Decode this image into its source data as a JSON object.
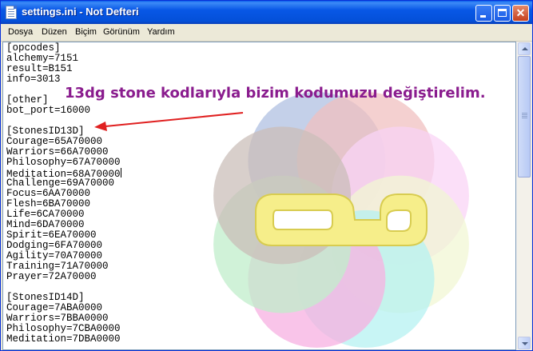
{
  "window": {
    "title": "settings.ini - Not Defteri"
  },
  "menu": [
    "Dosya",
    "Düzen",
    "Biçim",
    "Görünüm",
    "Yardım"
  ],
  "document": {
    "lines": [
      "[opcodes]",
      "alchemy=7151",
      "result=B151",
      "info=3013",
      "",
      "[other]",
      "bot_port=16000",
      "",
      "[StonesID13D]",
      "Courage=65A70000",
      "Warriors=66A70000",
      "Philosophy=67A70000",
      "Meditation=68A70000",
      "Challenge=69A70000",
      "Focus=6AA70000",
      "Flesh=6BA70000",
      "Life=6CA70000",
      "Mind=6DA70000",
      "Spirit=6EA70000",
      "Dodging=6FA70000",
      "Agility=70A70000",
      "Training=71A70000",
      "Prayer=72A70000",
      "",
      "[StonesID14D]",
      "Courage=7ABA0000",
      "Warriors=7BBA0000",
      "Philosophy=7CBA0000",
      "Meditation=7DBA0000"
    ],
    "cursor_line": 12
  },
  "annotation": {
    "text": "13dg stone kodlarıyla bizim kodumuzu değiştirelim.",
    "color": "#8a1c8e",
    "arrow_color": "#e02020"
  },
  "overlay_logo": {
    "icon": "flower-watermark-logo",
    "petal_colors": [
      "#6f8ec8",
      "#e48e8e",
      "#f4b0ee",
      "#e6f0b0",
      "#7ae6e6",
      "#f070c8",
      "#8ee0a0",
      "#a08a80"
    ],
    "emblem_color": "#f6ee8a"
  }
}
